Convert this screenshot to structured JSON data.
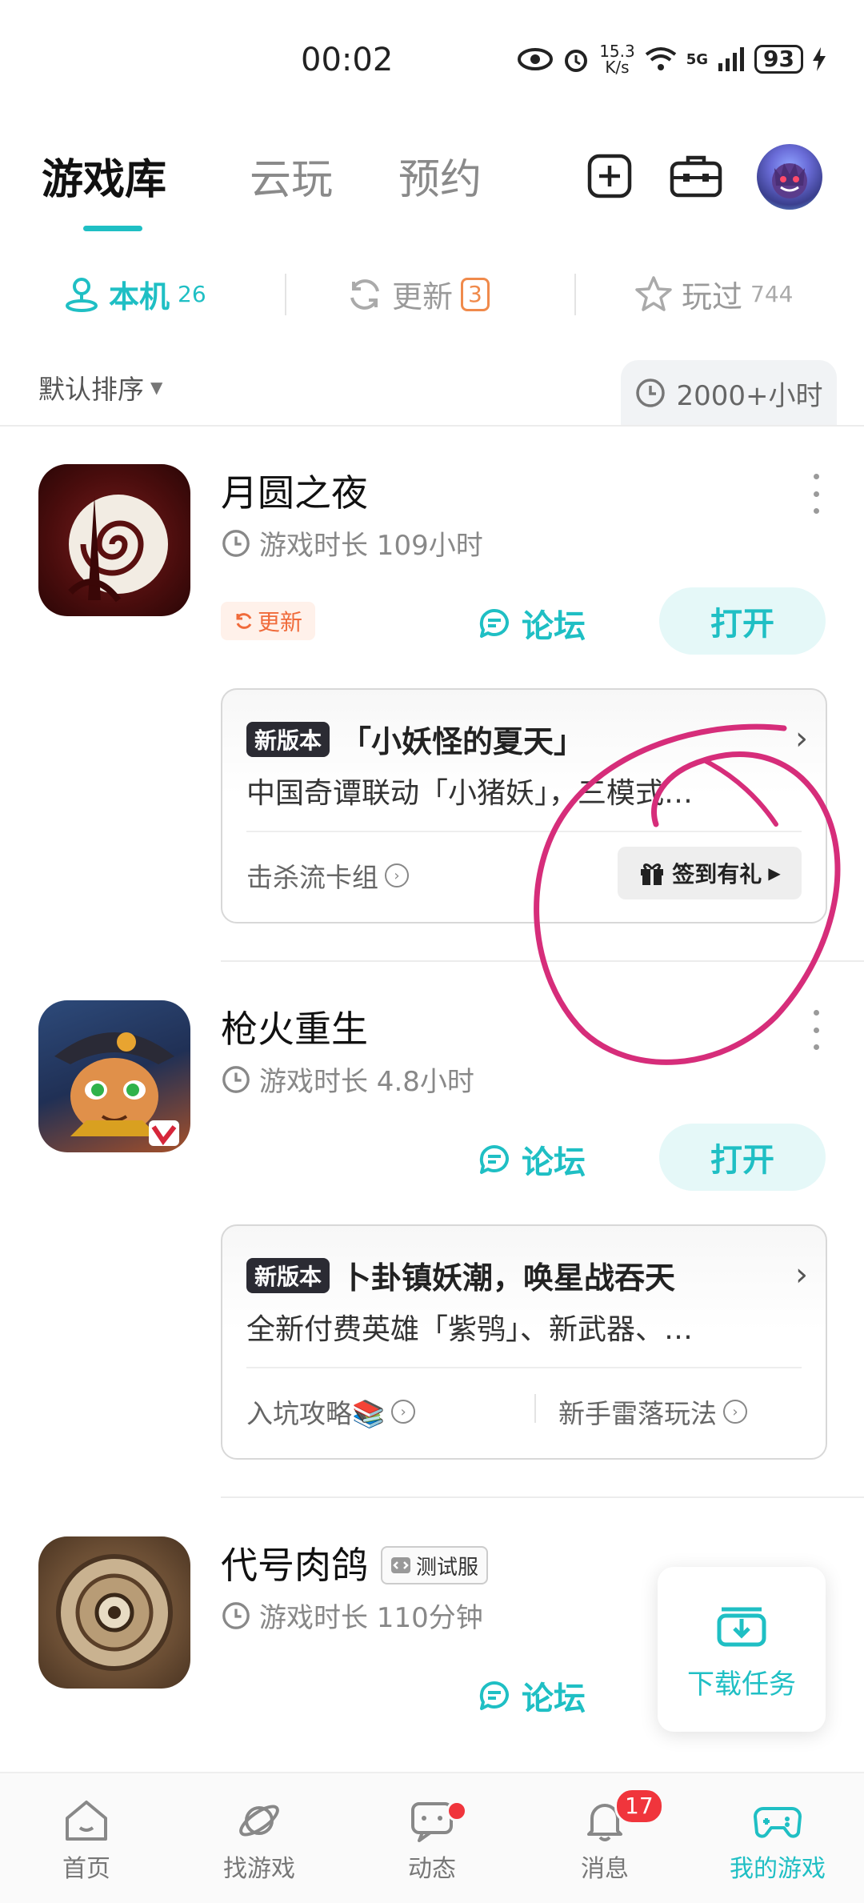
{
  "status_bar": {
    "time": "00:02",
    "net_speed_value": "15.3",
    "net_speed_unit": "K/s",
    "network": "5G",
    "battery": "93"
  },
  "header": {
    "tabs": [
      {
        "label": "游戏库"
      },
      {
        "label": "云玩"
      },
      {
        "label": "预约"
      }
    ],
    "icons": [
      "add-icon",
      "toolbox-icon",
      "avatar"
    ]
  },
  "subtabs": [
    {
      "label": "本机",
      "count": "26"
    },
    {
      "label": "更新",
      "count": "3"
    },
    {
      "label": "玩过",
      "count": "744"
    }
  ],
  "sort": {
    "label": "默认排序",
    "playtime_filter": "2000+小时"
  },
  "games": [
    {
      "name": "月圆之夜",
      "playtime": "游戏时长 109小时",
      "update_label": "更新",
      "forum_label": "论坛",
      "open_label": "打开",
      "card": {
        "badge": "新版本",
        "title": "「小妖怪的夏天」",
        "desc": "中国奇谭联动「小猪妖」，三模式…",
        "foot_left": "击杀流卡组",
        "gift_label": "签到有礼"
      }
    },
    {
      "name": "枪火重生",
      "playtime": "游戏时长 4.8小时",
      "forum_label": "论坛",
      "open_label": "打开",
      "card": {
        "badge": "新版本",
        "title": "卜卦镇妖潮，唤星战吞天",
        "desc": "全新付费英雄「紫鸮」、新武器、…",
        "foot_left": "入坑攻略📚",
        "foot_right": "新手雷落玩法"
      }
    },
    {
      "name": "代号肉鸽",
      "beta_tag": "测试服",
      "playtime": "游戏时长 110分钟",
      "forum_label": "论坛"
    }
  ],
  "download_task": {
    "label": "下载任务"
  },
  "bottom_nav": [
    {
      "label": "首页"
    },
    {
      "label": "找游戏"
    },
    {
      "label": "动态"
    },
    {
      "label": "消息",
      "badge": "17"
    },
    {
      "label": "我的游戏"
    }
  ],
  "colors": {
    "accent": "#1fbfc4",
    "update_orange": "#f08a4b",
    "annotation": "#d62d7a",
    "badge_red": "#f0353c"
  }
}
